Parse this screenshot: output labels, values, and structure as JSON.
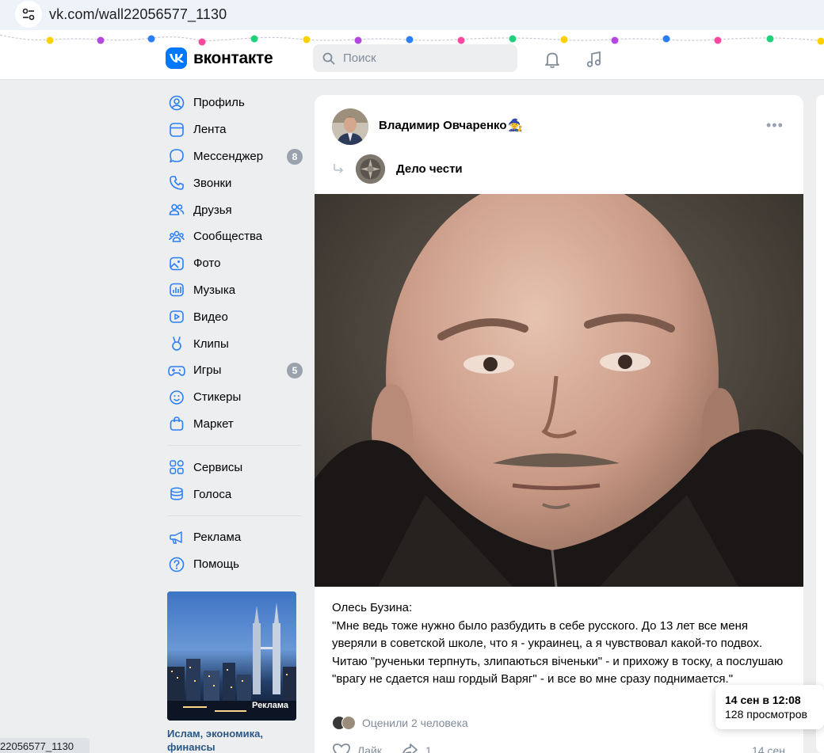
{
  "browser": {
    "url": "vk.com/wall22056577_1130",
    "status_url": "22056577_1130"
  },
  "header": {
    "logo_text": "вконтакте",
    "logo_letter": "VK",
    "search_placeholder": "Поиск",
    "brand_color": "#0077ff"
  },
  "sidebar": {
    "items": [
      {
        "label": "Профиль",
        "icon": "user-circle-icon"
      },
      {
        "label": "Лента",
        "icon": "news-feed-icon"
      },
      {
        "label": "Мессенджер",
        "icon": "message-icon",
        "badge": "8"
      },
      {
        "label": "Звонки",
        "icon": "phone-icon"
      },
      {
        "label": "Друзья",
        "icon": "friends-icon"
      },
      {
        "label": "Сообщества",
        "icon": "communities-icon"
      },
      {
        "label": "Фото",
        "icon": "photo-icon"
      },
      {
        "label": "Музыка",
        "icon": "music-icon"
      },
      {
        "label": "Видео",
        "icon": "video-icon"
      },
      {
        "label": "Клипы",
        "icon": "clips-icon"
      },
      {
        "label": "Игры",
        "icon": "gamepad-icon",
        "badge": "5"
      },
      {
        "label": "Стикеры",
        "icon": "smile-icon"
      },
      {
        "label": "Маркет",
        "icon": "bag-icon"
      }
    ],
    "extra_items": [
      {
        "label": "Сервисы",
        "icon": "services-icon"
      },
      {
        "label": "Голоса",
        "icon": "coins-icon"
      }
    ],
    "footer_items": [
      {
        "label": "Реклама",
        "icon": "megaphone-icon"
      },
      {
        "label": "Помощь",
        "icon": "help-icon"
      }
    ],
    "ad": {
      "label": "Реклама",
      "title": "Ислам, экономика, финансы"
    }
  },
  "post": {
    "author": "Владимир Овчаренко",
    "author_emoji": "🧙",
    "repost_source": "Дело чести",
    "text_lines": [
      "Олесь Бузина:",
      "\"Мне ведь тоже нужно было разбудить в себе русского. До 13 лет все меня уверяли в советской школе, что я - украинец, а я чувствовал какой-то подвох. Читаю \"рученьки терпнуть, злипаються віченьки\" - и прихожу в тоску, а послушаю \"врагу не сдается наш гордый Варяг\" - и все во мне сразу поднимается.\""
    ],
    "likers_text": "Оценили 2 человека",
    "like_label": "Лайк",
    "share_count": "1",
    "date_short": "14 сен"
  },
  "tooltip": {
    "date": "14 сен в 12:08",
    "views": "128 просмотров"
  }
}
